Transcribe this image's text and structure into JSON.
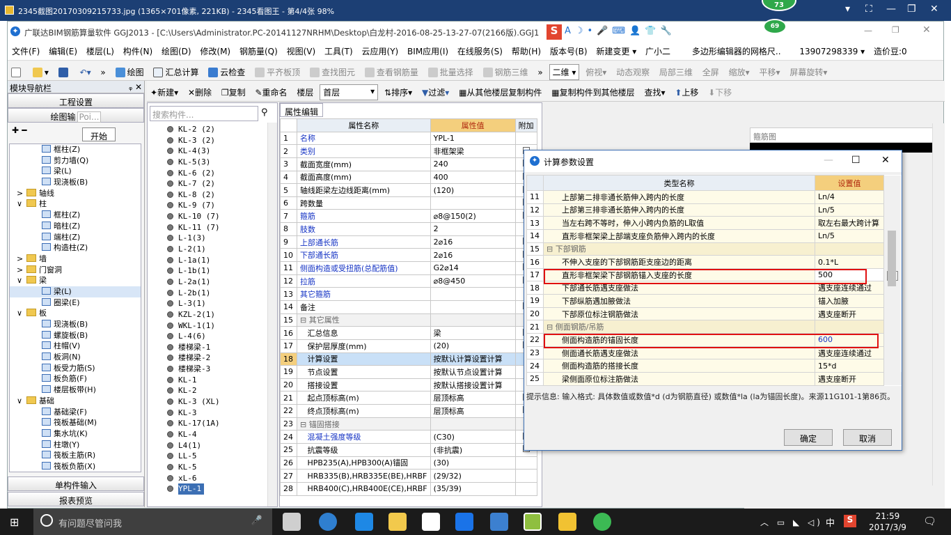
{
  "viewer": {
    "title": "2345截图20170309215733.jpg (1365×701像素, 221KB) - 2345看图王 - 第4/4张 98%",
    "badge_top": "73",
    "badge_app": "69"
  },
  "app": {
    "title": "广联达BIM钢筋算量软件 GGJ2013 - [C:\\Users\\Administrator.PC-20141127NRHM\\Desktop\\白龙村-2016-08-25-13-27-07(2166版).GGJ1"
  },
  "menu": [
    "文件(F)",
    "编辑(E)",
    "楼层(L)",
    "构件(N)",
    "绘图(D)",
    "修改(M)",
    "钢筋量(Q)",
    "视图(V)",
    "工具(T)",
    "云应用(Y)",
    "BIM应用(I)",
    "在线服务(S)",
    "帮助(H)",
    "版本号(B)",
    "新建变更 ▾",
    "广小二",
    "多边形编辑器的网格尺..",
    "13907298339 ▾",
    "造价豆:0"
  ],
  "toolbar1": {
    "draw": "绘图",
    "sum": "汇总计算",
    "cloud": "云检查",
    "flat": "平齐板顶",
    "find": "查找图元",
    "view": "查看钢筋量",
    "batch": "批量选择",
    "steel3d": "钢筋三维",
    "view2d": "二维",
    "persp": "俯视",
    "dynamic": "动态观察",
    "local3d": "局部三维",
    "full": "全屏",
    "zoom": "缩放",
    "pan": "平移",
    "rotate": "屏幕旋转"
  },
  "nav": {
    "header": "模块导航栏",
    "pin": "ᵩ ✕",
    "btn_project": "工程设置",
    "btn_draw": "绘图输",
    "popup_input": "Poi...",
    "popup_start": "开始",
    "btn_single": "单构件输入",
    "btn_report": "报表预览"
  },
  "tree": [
    {
      "lvl": 1,
      "label": "框柱(Z)",
      "kind": "i"
    },
    {
      "lvl": 1,
      "label": "剪力墙(Q)",
      "kind": "i"
    },
    {
      "lvl": 1,
      "label": "梁(L)",
      "kind": "i"
    },
    {
      "lvl": 1,
      "label": "现浇板(B)",
      "kind": "i"
    },
    {
      "lvl": 0,
      "label": "轴线",
      "kind": "f",
      "tw": ">"
    },
    {
      "lvl": 0,
      "label": "柱",
      "kind": "f",
      "tw": "∨"
    },
    {
      "lvl": 1,
      "label": "框柱(Z)",
      "kind": "i"
    },
    {
      "lvl": 1,
      "label": "暗柱(Z)",
      "kind": "i"
    },
    {
      "lvl": 1,
      "label": "端柱(Z)",
      "kind": "i"
    },
    {
      "lvl": 1,
      "label": "构造柱(Z)",
      "kind": "i"
    },
    {
      "lvl": 0,
      "label": "墙",
      "kind": "f",
      "tw": ">"
    },
    {
      "lvl": 0,
      "label": "门窗洞",
      "kind": "f",
      "tw": ">"
    },
    {
      "lvl": 0,
      "label": "梁",
      "kind": "f",
      "tw": "∨"
    },
    {
      "lvl": 1,
      "label": "梁(L)",
      "kind": "i",
      "sel": true
    },
    {
      "lvl": 1,
      "label": "圈梁(E)",
      "kind": "i"
    },
    {
      "lvl": 0,
      "label": "板",
      "kind": "f",
      "tw": "∨"
    },
    {
      "lvl": 1,
      "label": "现浇板(B)",
      "kind": "i"
    },
    {
      "lvl": 1,
      "label": "螺旋板(B)",
      "kind": "i"
    },
    {
      "lvl": 1,
      "label": "柱帽(V)",
      "kind": "i"
    },
    {
      "lvl": 1,
      "label": "板洞(N)",
      "kind": "i"
    },
    {
      "lvl": 1,
      "label": "板受力筋(S)",
      "kind": "i"
    },
    {
      "lvl": 1,
      "label": "板负筋(F)",
      "kind": "i"
    },
    {
      "lvl": 1,
      "label": "楼层板带(H)",
      "kind": "i"
    },
    {
      "lvl": 0,
      "label": "基础",
      "kind": "f",
      "tw": "∨"
    },
    {
      "lvl": 1,
      "label": "基础梁(F)",
      "kind": "i"
    },
    {
      "lvl": 1,
      "label": "筏板基础(M)",
      "kind": "i"
    },
    {
      "lvl": 1,
      "label": "集水坑(K)",
      "kind": "i"
    },
    {
      "lvl": 1,
      "label": "柱墩(Y)",
      "kind": "i"
    },
    {
      "lvl": 1,
      "label": "筏板主筋(R)",
      "kind": "i"
    },
    {
      "lvl": 1,
      "label": "筏板负筋(X)",
      "kind": "i"
    }
  ],
  "toolbar2": {
    "new": "新建",
    "del": "删除",
    "copy": "复制",
    "rename": "重命名",
    "floor_label": "楼层",
    "floor": "首层",
    "sort": "排序",
    "filter": "过滤",
    "copy_from": "从其他楼层复制构件",
    "copy_to": "复制构件到其他楼层",
    "find": "查找",
    "up": "上移",
    "down": "下移"
  },
  "search": {
    "placeholder": "搜索构件..."
  },
  "components": [
    "KL-2 (2)",
    "KL-3 (2)",
    "KL-4(3)",
    "KL-5(3)",
    "KL-6 (2)",
    "KL-7 (2)",
    "KL-8 (2)",
    "KL-9 (7)",
    "KL-10 (7)",
    "KL-11 (7)",
    "L-1(3)",
    "L-2(1)",
    "L-1a(1)",
    "L-1b(1)",
    "L-2a(1)",
    "L-2b(1)",
    "L-3(1)",
    "KZL-2(1)",
    "WKL-1(1)",
    "L-4(6)",
    "楼梯梁-1",
    "楼梯梁-2",
    "楼梯梁-3",
    "KL-1",
    "KL-2",
    "KL-3 (XL)",
    "KL-3",
    "KL-17(1A)",
    "KL-4",
    "L4(1)",
    "LL-5",
    "KL-5",
    "xL-6",
    "YPL-1"
  ],
  "props": {
    "tab": "属性编辑",
    "h_name": "属性名称",
    "h_val": "属性值",
    "h_extra": "附加",
    "rows": [
      {
        "n": "1",
        "name": "名称",
        "val": "YPL-1",
        "c": "blue",
        "cb": false
      },
      {
        "n": "2",
        "name": "类别",
        "val": "非框架梁",
        "c": "blue",
        "cb": true
      },
      {
        "n": "3",
        "name": "截面宽度(mm)",
        "val": "240",
        "cb": true
      },
      {
        "n": "4",
        "name": "截面高度(mm)",
        "val": "400",
        "cb": true
      },
      {
        "n": "5",
        "name": "轴线距梁左边线距离(mm)",
        "val": "(120)",
        "cb": true
      },
      {
        "n": "6",
        "name": "跨数量",
        "val": "",
        "cb": true
      },
      {
        "n": "7",
        "name": "箍筋",
        "val": "⌀8@150(2)",
        "c": "blue",
        "cb": true
      },
      {
        "n": "8",
        "name": "肢数",
        "val": "2",
        "c": "blue",
        "cb": false
      },
      {
        "n": "9",
        "name": "上部通长筋",
        "val": "2⌀16",
        "c": "blue",
        "cb": true
      },
      {
        "n": "10",
        "name": "下部通长筋",
        "val": "2⌀16",
        "c": "blue",
        "cb": true
      },
      {
        "n": "11",
        "name": "侧面构造或受扭筋(总配筋值)",
        "val": "G2⌀14",
        "c": "blue",
        "cb": true
      },
      {
        "n": "12",
        "name": "拉筋",
        "val": "⌀8@450",
        "c": "blue",
        "cb": true
      },
      {
        "n": "13",
        "name": "其它箍筋",
        "val": "",
        "c": "blue",
        "cb": false
      },
      {
        "n": "14",
        "name": "备注",
        "val": "",
        "cb": true
      },
      {
        "n": "15",
        "name": "⊟ 其它属性",
        "val": "",
        "g": true
      },
      {
        "n": "16",
        "name": "   汇总信息",
        "val": "梁",
        "cb": true
      },
      {
        "n": "17",
        "name": "   保护层厚度(mm)",
        "val": "(20)",
        "cb": true
      },
      {
        "n": "18",
        "name": "   计算设置",
        "val": "按默认计算设置计算",
        "sel": true
      },
      {
        "n": "19",
        "name": "   节点设置",
        "val": "按默认节点设置计算"
      },
      {
        "n": "20",
        "name": "   搭接设置",
        "val": "按默认搭接设置计算"
      },
      {
        "n": "21",
        "name": "   起点顶标高(m)",
        "val": "层顶标高",
        "cb": true
      },
      {
        "n": "22",
        "name": "   终点顶标高(m)",
        "val": "层顶标高",
        "cb": true
      },
      {
        "n": "23",
        "name": "⊟ 锚固搭接",
        "val": "",
        "g": true
      },
      {
        "n": "24",
        "name": "   混凝土强度等级",
        "val": "(C30)",
        "c": "blue",
        "cb": true
      },
      {
        "n": "25",
        "name": "   抗震等级",
        "val": "(非抗震)",
        "cb": true
      },
      {
        "n": "26",
        "name": "   HPB235(A),HPB300(A)锚固",
        "val": "(30)"
      },
      {
        "n": "27",
        "name": "   HRB335(B),HRB335E(BE),HRBF",
        "val": "(29/32)"
      },
      {
        "n": "28",
        "name": "   HRB400(C),HRB400E(CE),HRBF",
        "val": "(35/39)"
      }
    ]
  },
  "right": {
    "header": "箍筋图"
  },
  "dialog": {
    "title": "计算参数设置",
    "h_name": "类型名称",
    "h_val": "设置值",
    "rows": [
      {
        "n": "11",
        "name": "上部第二排非通长筋伸入跨内的长度",
        "val": "Ln/4"
      },
      {
        "n": "12",
        "name": "上部第三排非通长筋伸入跨内的长度",
        "val": "Ln/5"
      },
      {
        "n": "13",
        "name": "当左右跨不等时，伸入小跨内负筋的L取值",
        "val": "取左右最大跨计算"
      },
      {
        "n": "14",
        "name": "直形非框架梁上部端支座负筋伸入跨内的长度",
        "val": "Ln/5"
      },
      {
        "n": "15",
        "name": "⊟ 下部钢筋",
        "val": "",
        "g": true
      },
      {
        "n": "16",
        "name": "不伸入支座的下部钢筋距支座边的距离",
        "val": "0.1*L"
      },
      {
        "n": "17",
        "name": "直形非框架梁下部钢筋锚入支座的长度",
        "val": "500",
        "edit": true
      },
      {
        "n": "18",
        "name": "下部通长筋遇支座做法",
        "val": "遇支座连续通过"
      },
      {
        "n": "19",
        "name": "下部纵筋遇加腋做法",
        "val": "锚入加腋"
      },
      {
        "n": "20",
        "name": "下部原位标注钢筋做法",
        "val": "遇支座断开"
      },
      {
        "n": "21",
        "name": "⊟ 侧面钢筋/吊筋",
        "val": "",
        "g": true
      },
      {
        "n": "22",
        "name": "侧面构造筋的锚固长度",
        "val": "600",
        "c": "blue"
      },
      {
        "n": "23",
        "name": "侧面通长筋遇支座做法",
        "val": "遇支座连续通过"
      },
      {
        "n": "24",
        "name": "侧面构造筋的搭接长度",
        "val": "15*d"
      },
      {
        "n": "25",
        "name": "梁侧面原位标注筋做法",
        "val": "遇支座断开"
      }
    ],
    "hint": "提示信息: 输入格式: 具体数值或数值*d (d为钢筋直径) 或数值*la (la为锚固长度)。来源11G101-1第86页。",
    "ok": "确定",
    "cancel": "取消",
    "more": "···"
  },
  "taskbar": {
    "search": "有问题尽管问我",
    "time": "21:59",
    "date": "2017/3/9",
    "ime": "中"
  }
}
